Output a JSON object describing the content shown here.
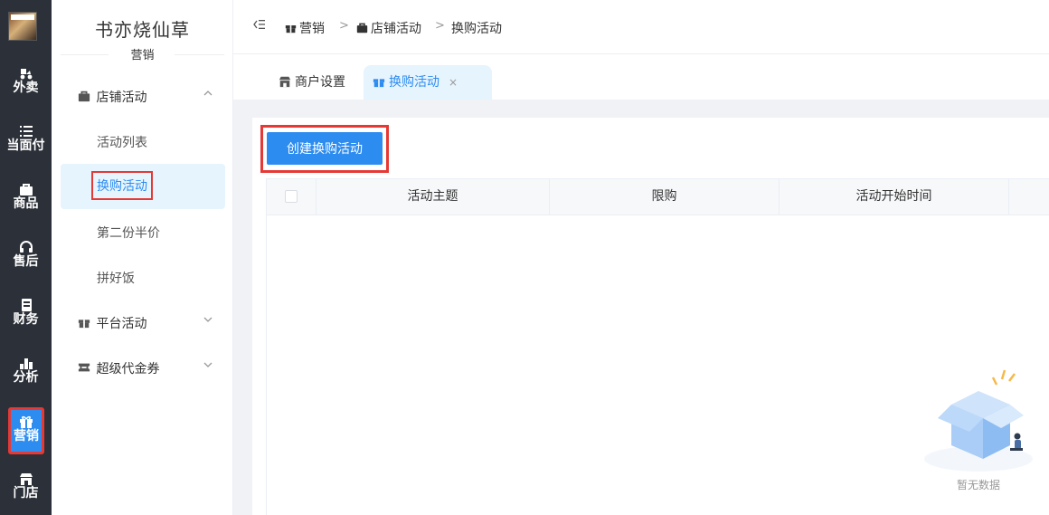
{
  "rail": {
    "items": [
      {
        "label": "外卖",
        "icon": "scooter-icon"
      },
      {
        "label": "当面付",
        "icon": "list-icon"
      },
      {
        "label": "商品",
        "icon": "bag-icon"
      },
      {
        "label": "售后",
        "icon": "headset-icon"
      },
      {
        "label": "财务",
        "icon": "ledger-icon"
      },
      {
        "label": "分析",
        "icon": "bar-chart-icon"
      },
      {
        "label": "营销",
        "icon": "gift-icon"
      },
      {
        "label": "门店",
        "icon": "shop-icon"
      }
    ],
    "active_index": 6
  },
  "sidebar": {
    "store_name": "书亦烧仙草",
    "section": "营销",
    "groups": [
      {
        "label": "店铺活动",
        "icon": "bag-icon",
        "expanded": true,
        "items": [
          "活动列表",
          "换购活动",
          "第二份半价",
          "拼好饭"
        ]
      },
      {
        "label": "平台活动",
        "icon": "gift-icon",
        "expanded": false
      },
      {
        "label": "超级代金券",
        "icon": "ticket-icon",
        "expanded": false
      }
    ],
    "active_item": "换购活动"
  },
  "breadcrumb": {
    "items": [
      "营销",
      "店铺活动",
      "换购活动"
    ],
    "separator": ">"
  },
  "tabs": [
    {
      "label": "商户设置",
      "icon": "shop-icon"
    },
    {
      "label": "换购活动",
      "icon": "gift-icon",
      "closable": true,
      "close_label": "×"
    }
  ],
  "toolbar": {
    "create_label": "创建换购活动"
  },
  "table": {
    "columns": [
      "活动主题",
      "限购",
      "活动开始时间"
    ],
    "rows": []
  },
  "empty_state": {
    "text": "暂无数据"
  },
  "colors": {
    "accent": "#2d8cf0",
    "rail_bg": "#2c3038",
    "highlight_border": "#e53935",
    "active_bg": "#e6f4fe"
  }
}
